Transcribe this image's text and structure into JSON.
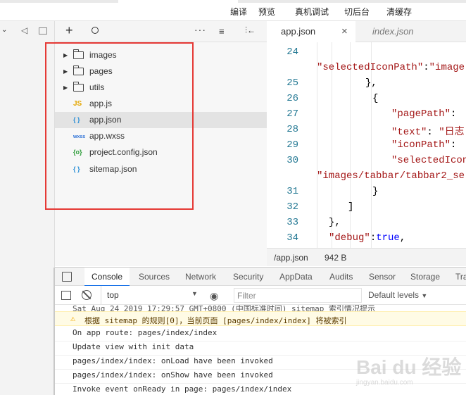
{
  "menu": [
    "编译",
    "预览",
    "真机调试",
    "切后台",
    "清缓存"
  ],
  "explorer": {
    "items": [
      {
        "type": "folder",
        "name": "images"
      },
      {
        "type": "folder",
        "name": "pages"
      },
      {
        "type": "folder",
        "name": "utils"
      },
      {
        "type": "js",
        "icon": "JS",
        "name": "app.js"
      },
      {
        "type": "json",
        "icon": "{ }",
        "name": "app.json"
      },
      {
        "type": "wxss",
        "icon": "wxss",
        "name": "app.wxss"
      },
      {
        "type": "config",
        "icon": "{o}",
        "name": "project.config.json"
      },
      {
        "type": "json",
        "icon": "{ }",
        "name": "sitemap.json"
      }
    ]
  },
  "editor": {
    "tabs": [
      {
        "label": "app.json",
        "active": true,
        "close": "×"
      },
      {
        "label": "index.json",
        "active": false
      }
    ],
    "status_path": "/app.json",
    "status_size": "942 B",
    "line_numbers": [
      "24",
      "25",
      "26",
      "27",
      "28",
      "29",
      "30",
      "31",
      "32",
      "33",
      "34"
    ]
  },
  "console": {
    "tabs": [
      "Console",
      "Sources",
      "Network",
      "Security",
      "AppData",
      "Audits",
      "Sensor",
      "Storage",
      "Tra"
    ],
    "context": "top",
    "filter_placeholder": "Filter",
    "levels": "Default levels",
    "top_line": "Sat Aug 24 2019 17:29:57 GMT+0800 (中国标准时间) sitemap 索引情况提示",
    "warning": "根据 sitemap 的规则[0]，当前页面 [pages/index/index] 将被索引",
    "logs": [
      "On app route: pages/index/index",
      "Update view with init data",
      "pages/index/index: onLoad have been invoked",
      "pages/index/index: onShow have been invoked",
      "Invoke event onReady in page: pages/index/index"
    ]
  },
  "watermark": "Bai du 经验",
  "watermark_sub": "jingyan.baidu.com"
}
